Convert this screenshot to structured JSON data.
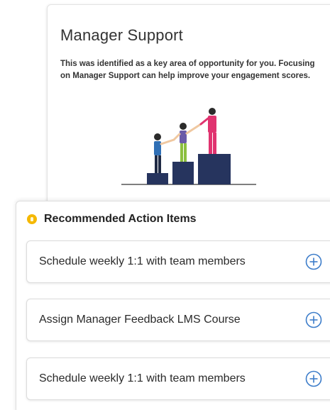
{
  "focus_card": {
    "title": "Manager Support",
    "description": "This was identified as a key area of opportunity for you. Focusing on Manager Support can help improve your engagement scores."
  },
  "recommended": {
    "header": "Recommended Action Items",
    "icon": "lightbulb-icon",
    "items": [
      {
        "label": "Schedule weekly 1:1 with team members",
        "icon": "add-circle-icon"
      },
      {
        "label": "Assign Manager Feedback LMS Course",
        "icon": "add-circle-icon"
      },
      {
        "label": "Schedule weekly 1:1 with team members",
        "icon": "add-circle-icon"
      }
    ]
  },
  "colors": {
    "accent": "#3d7dca",
    "bulb": "#f5b800",
    "navy": "#26345e"
  }
}
